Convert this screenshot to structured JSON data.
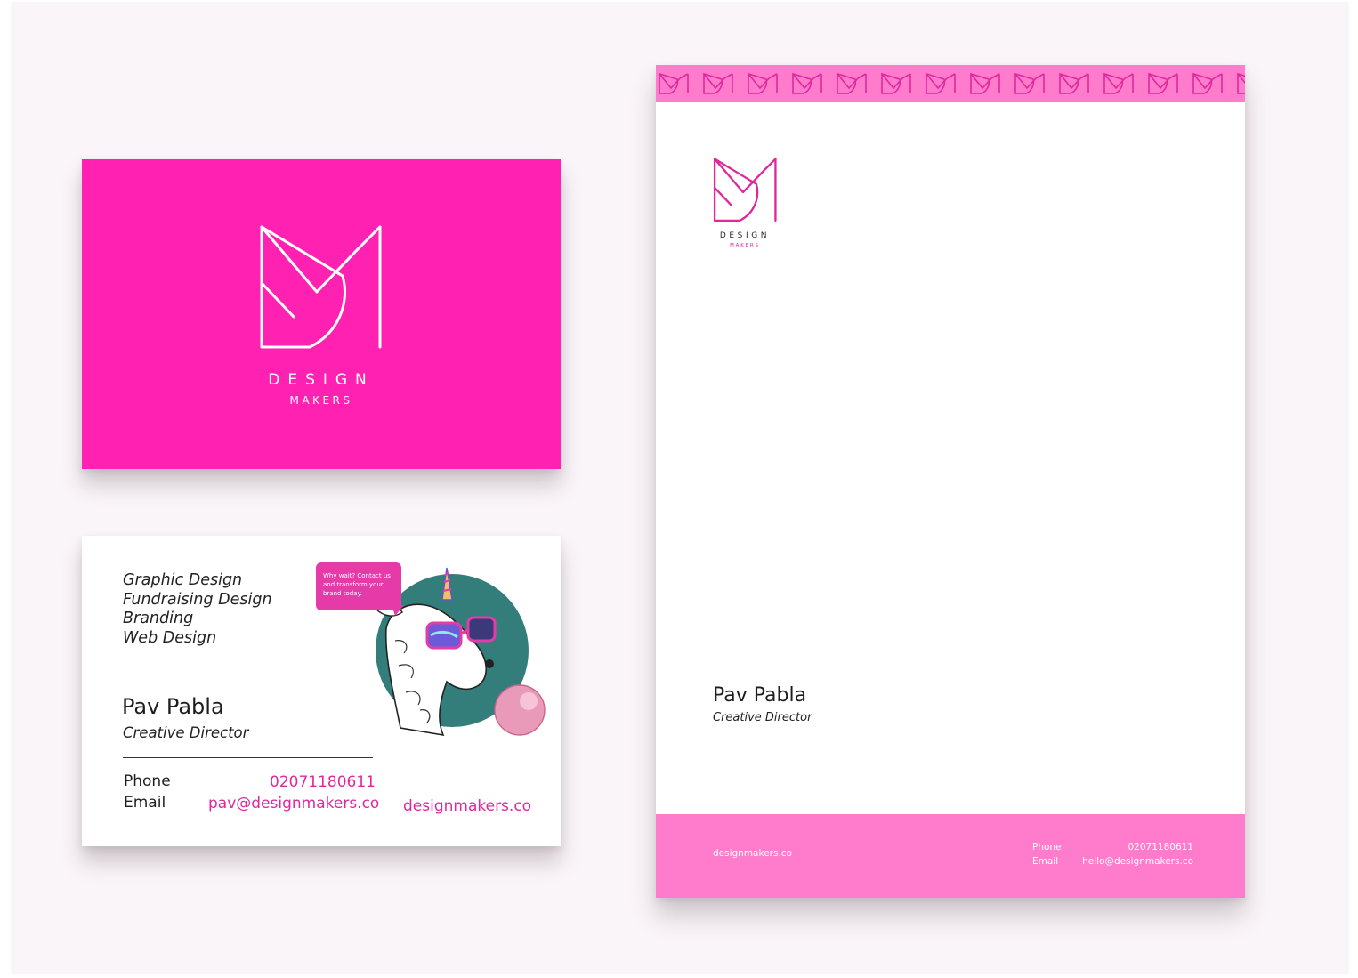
{
  "brand": {
    "design": "DESIGN",
    "makers": "MAKERS",
    "pink": "#ff22b2",
    "light_pink": "#ff7ccd",
    "accent_text": "#e0289d"
  },
  "business_card": {
    "services": [
      "Graphic Design",
      "Fundraising Design",
      "Branding",
      "Web Design"
    ],
    "name": "Pav Pabla",
    "role": "Creative Director",
    "phone_label": "Phone",
    "phone": "02071180611",
    "email_label": "Email",
    "email": "pav@designmakers.co",
    "website": "designmakers.co",
    "speech_bubble": "Why wait? Contact us and transform your brand today."
  },
  "letterhead": {
    "name": "Pav Pabla",
    "role": "Creative Director",
    "website": "designmakers.co",
    "phone_label": "Phone",
    "phone": "02071180611",
    "email_label": "Email",
    "email": "hello@designmakers.co"
  }
}
